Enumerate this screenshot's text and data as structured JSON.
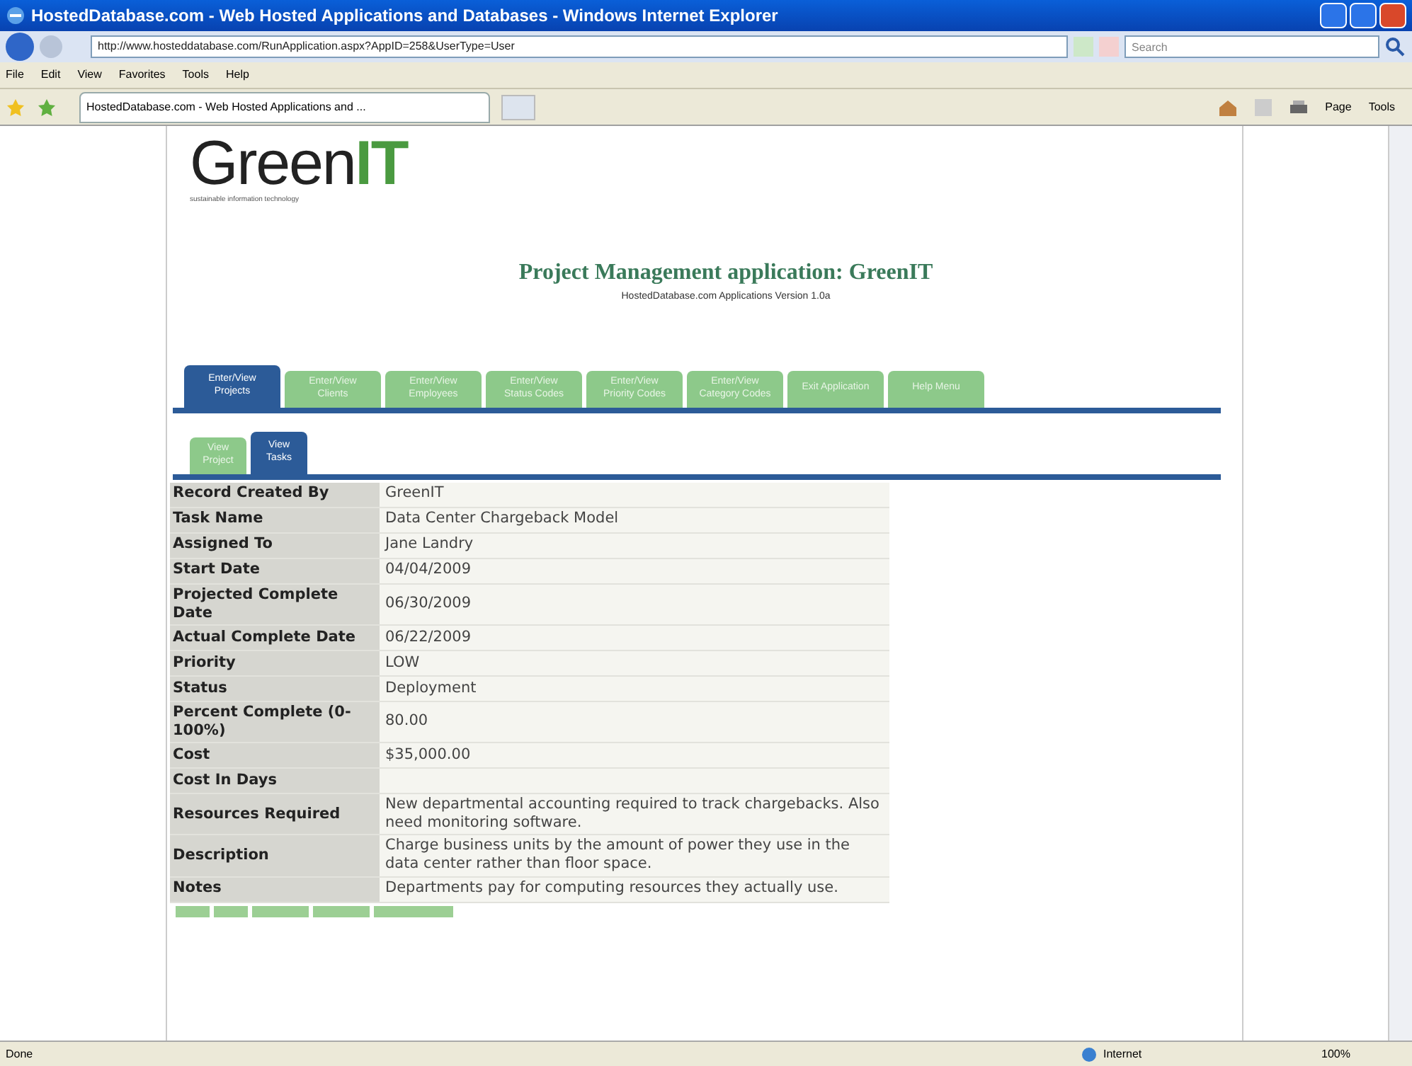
{
  "window": {
    "title": "HostedDatabase.com - Web Hosted Applications and Databases - Windows Internet Explorer"
  },
  "address_bar": {
    "url": "http://www.hosteddatabase.com/RunApplication.aspx?AppID=258&UserType=User",
    "search_placeholder": "Search"
  },
  "menu": [
    "File",
    "Edit",
    "View",
    "Favorites",
    "Tools",
    "Help"
  ],
  "browser_tab": {
    "title": "HostedDatabase.com - Web Hosted Applications and ..."
  },
  "command_bar": [
    "Page",
    "Tools"
  ],
  "logo": {
    "main": "Green",
    "accent": "IT",
    "tagline": "sustainable information technology"
  },
  "heading": {
    "title": "Project Management application: GreenIT",
    "subtitle": "HostedDatabase.com Applications Version 1.0a"
  },
  "tabs": [
    {
      "label": "Enter/View Projects",
      "selected": true
    },
    {
      "label": "Enter/View Clients",
      "selected": false
    },
    {
      "label": "Enter/View Employees",
      "selected": false
    },
    {
      "label": "Enter/View Status Codes",
      "selected": false
    },
    {
      "label": "Enter/View Priority Codes",
      "selected": false
    },
    {
      "label": "Enter/View Category Codes",
      "selected": false
    },
    {
      "label": "Exit Application",
      "selected": false
    },
    {
      "label": "Help Menu",
      "selected": false
    }
  ],
  "subtabs": [
    {
      "label": "View Project",
      "selected": false
    },
    {
      "label": "View Tasks",
      "selected": true
    }
  ],
  "record": [
    {
      "label": "Record Created By",
      "value": "GreenIT"
    },
    {
      "label": "Task Name",
      "value": "Data Center Chargeback Model"
    },
    {
      "label": "Assigned To",
      "value": "Jane Landry"
    },
    {
      "label": "Start Date",
      "value": "04/04/2009"
    },
    {
      "label": "Projected Complete Date",
      "value": "06/30/2009"
    },
    {
      "label": "Actual Complete Date",
      "value": "06/22/2009"
    },
    {
      "label": "Priority",
      "value": "LOW"
    },
    {
      "label": "Status",
      "value": "Deployment"
    },
    {
      "label": "Percent Complete (0-100%)",
      "value": "80.00"
    },
    {
      "label": "Cost",
      "value": "$35,000.00"
    },
    {
      "label": "Cost In Days"
    },
    {
      "label": "Resources Required",
      "value": "New departmental accounting required to track chargebacks. Also need monitoring software."
    },
    {
      "label": "Description",
      "value": "Charge business units by the amount of power they use in the data center rather than floor space."
    },
    {
      "label": "Notes",
      "value": "Departments pay for computing resources they actually use."
    }
  ],
  "status_bar": {
    "text": "Done",
    "zone": "Internet",
    "zoom": "100%"
  }
}
